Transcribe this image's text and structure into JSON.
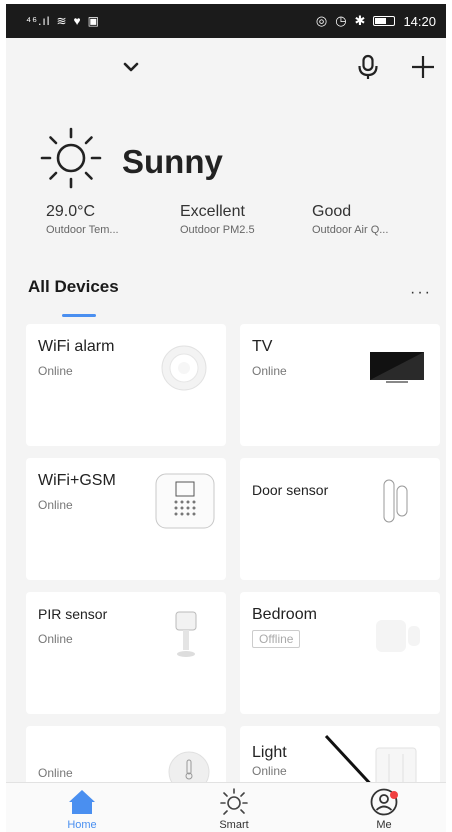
{
  "status_bar": {
    "signal": "⁴⁶.ıl",
    "time": "14:20"
  },
  "header": {
    "dropdown_icon": "chevron-down-icon",
    "mic_icon": "mic-icon",
    "add_icon": "plus-icon"
  },
  "weather": {
    "condition": "Sunny",
    "stats": [
      {
        "value": "29.0°C",
        "label": "Outdoor Tem..."
      },
      {
        "value": "Excellent",
        "label": "Outdoor PM2.5"
      },
      {
        "value": "Good",
        "label": "Outdoor Air Q..."
      }
    ]
  },
  "devices_section": {
    "title": "All Devices",
    "more": "···"
  },
  "devices": [
    {
      "name": "WiFi alarm",
      "status": "Online"
    },
    {
      "name": "TV",
      "status": "Online"
    },
    {
      "name": "WiFi+GSM",
      "status": "Online"
    },
    {
      "name": "Door sensor",
      "status": ""
    },
    {
      "name": "PIR sensor",
      "status": "Online"
    },
    {
      "name": "Bedroom",
      "status": "Offline"
    },
    {
      "name": "",
      "status": "Online"
    },
    {
      "name": "Light",
      "status": "Online"
    }
  ],
  "bottom_nav": [
    {
      "label": "Home",
      "icon": "home-icon",
      "active": true,
      "color": "#4a8ff0"
    },
    {
      "label": "Smart",
      "icon": "sun-icon",
      "active": false
    },
    {
      "label": "Me",
      "icon": "user-icon",
      "active": false
    }
  ],
  "colors": {
    "accent": "#4a8ff0",
    "badge": "#f04040"
  }
}
